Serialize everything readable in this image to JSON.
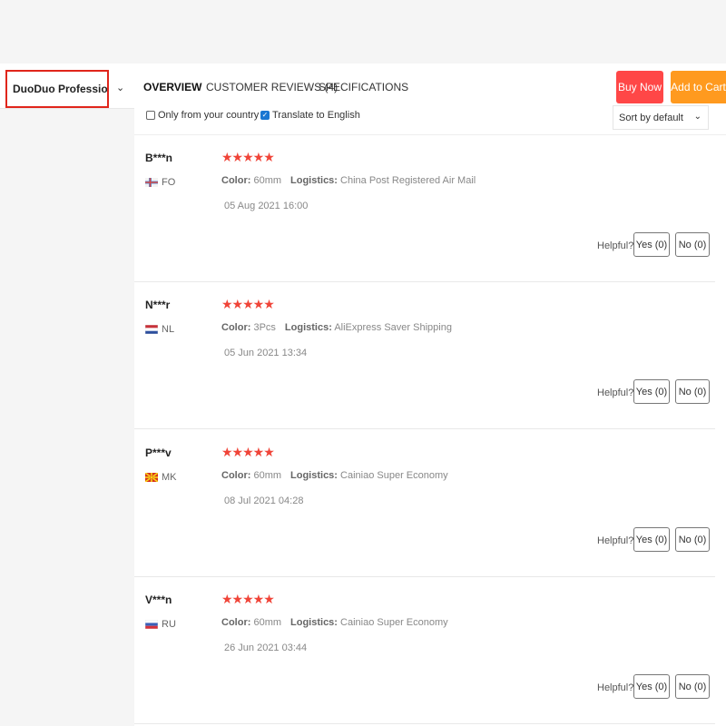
{
  "header": {
    "product_title": "DuoDuo Profession...",
    "tabs": [
      {
        "label": "OVERVIEW",
        "active": true
      },
      {
        "label": "CUSTOMER REVIEWS (4)",
        "active": false
      },
      {
        "label": "SPECIFICATIONS",
        "active": false
      }
    ],
    "buy_now": "Buy Now",
    "add_to_cart": "Add to Cart",
    "accent_buy": "#ff4747",
    "accent_cart": "#ff9a1f"
  },
  "filters": {
    "only_country": {
      "label": "Only from your country",
      "checked": false
    },
    "translate": {
      "label": "Translate to English",
      "checked": true
    },
    "sort_value": "Sort by default"
  },
  "reviews": [
    {
      "name": "B***n",
      "country": "FO",
      "flag": "fo-flag-icon",
      "stars": "★★★★★",
      "color_label": "Color:",
      "color": "60mm",
      "logistics_label": "Logistics:",
      "logistics": "China Post Registered Air Mail",
      "date": "05 Aug 2021 16:00",
      "helpful": "Helpful?",
      "yes": "Yes (0)",
      "no": "No (0)"
    },
    {
      "name": "N***r",
      "country": "NL",
      "flag": "nl-flag-icon",
      "stars": "★★★★★",
      "color_label": "Color:",
      "color": "3Pcs",
      "logistics_label": "Logistics:",
      "logistics": "AliExpress Saver Shipping",
      "date": "05 Jun 2021 13:34",
      "helpful": "Helpful?",
      "yes": "Yes (0)",
      "no": "No (0)"
    },
    {
      "name": "P***v",
      "country": "MK",
      "flag": "mk-flag-icon",
      "stars": "★★★★★",
      "color_label": "Color:",
      "color": "60mm",
      "logistics_label": "Logistics:",
      "logistics": "Cainiao Super Economy",
      "date": "08 Jul 2021 04:28",
      "helpful": "Helpful?",
      "yes": "Yes (0)",
      "no": "No (0)"
    },
    {
      "name": "V***n",
      "country": "RU",
      "flag": "ru-flag-icon",
      "stars": "★★★★★",
      "color_label": "Color:",
      "color": "60mm",
      "logistics_label": "Logistics:",
      "logistics": "Cainiao Super Economy",
      "date": "26 Jun 2021 03:44",
      "helpful": "Helpful?",
      "yes": "Yes (0)",
      "no": "No (0)"
    }
  ]
}
